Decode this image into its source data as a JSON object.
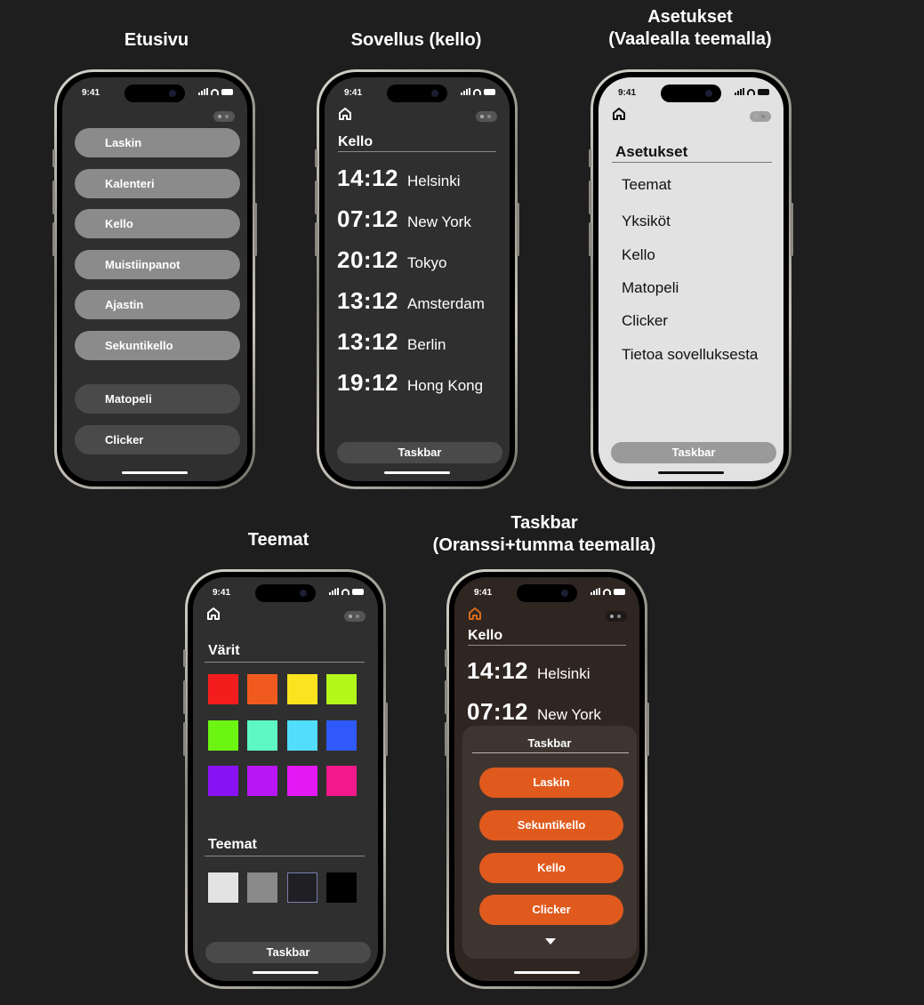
{
  "frames": {
    "etusivu": {
      "title": "Etusivu"
    },
    "kello": {
      "title": "Sovellus (kello)"
    },
    "asetukset": {
      "title_line1": "Asetukset",
      "title_line2": "(Vaalealla teemalla)"
    },
    "teemat": {
      "title": "Teemat"
    },
    "taskbar": {
      "title_line1": "Taskbar",
      "title_line2": "(Oranssi+tumma teemalla)"
    }
  },
  "status": {
    "time": "9:41"
  },
  "home": {
    "buttons": [
      "Laskin",
      "Kalenteri",
      "Kello",
      "Muistiinpanot",
      "Ajastin",
      "Sekuntikello"
    ],
    "games": [
      "Matopeli",
      "Clicker"
    ]
  },
  "clock": {
    "heading": "Kello",
    "rows": [
      {
        "time": "14:12",
        "city": "Helsinki"
      },
      {
        "time": "07:12",
        "city": "New York"
      },
      {
        "time": "20:12",
        "city": "Tokyo"
      },
      {
        "time": "13:12",
        "city": "Amsterdam"
      },
      {
        "time": "13:12",
        "city": "Berlin"
      },
      {
        "time": "19:12",
        "city": "Hong Kong"
      }
    ],
    "taskbar": "Taskbar"
  },
  "settings": {
    "heading": "Asetukset",
    "items": [
      "Teemat",
      "Yksiköt",
      "Kello",
      "Matopeli",
      "Clicker",
      "Tietoa sovelluksesta"
    ],
    "taskbar": "Taskbar"
  },
  "themes": {
    "colors_heading": "Värit",
    "colors": [
      "#f41d1d",
      "#f15a1f",
      "#fbe41f",
      "#b3f71a",
      "#6cf412",
      "#5ef8c4",
      "#51ddfb",
      "#2f59f9",
      "#8a13f6",
      "#b916f6",
      "#e318f5",
      "#f3188b"
    ],
    "themes_heading": "Teemat",
    "themes": [
      "#e3e3e3",
      "#8a8a8a",
      "#1f1f24",
      "#000000"
    ],
    "taskbar": "Taskbar"
  },
  "taskbar_view": {
    "heading": "Kello",
    "rows": [
      {
        "time": "14:12",
        "city": "Helsinki"
      },
      {
        "time": "07:12",
        "city": "New York"
      }
    ],
    "popup_title": "Taskbar",
    "items": [
      "Laskin",
      "Sekuntikello",
      "Kello",
      "Clicker"
    ]
  }
}
